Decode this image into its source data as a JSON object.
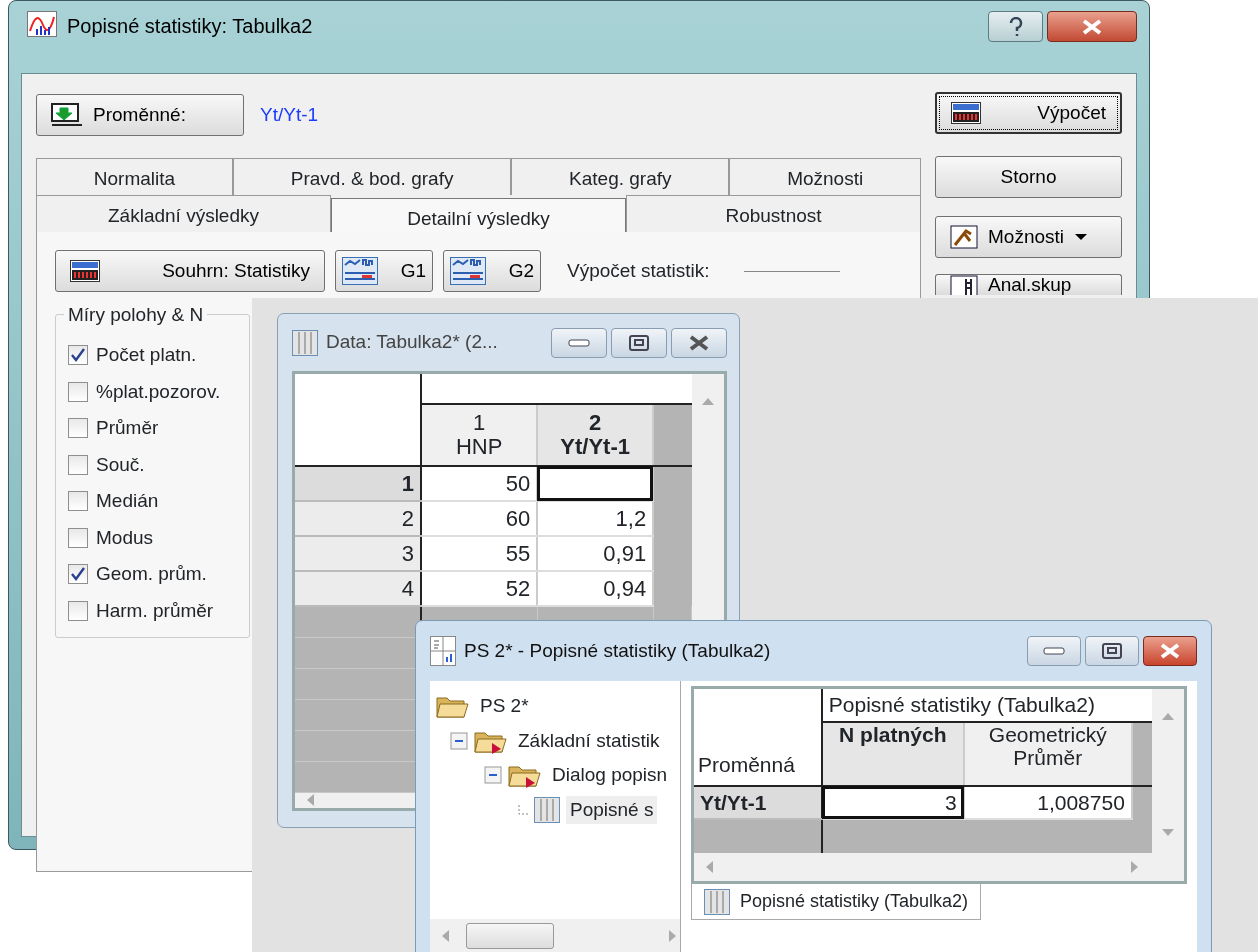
{
  "dialog": {
    "title": "Popisné statistiky: Tabulka2",
    "variables_button": "Proměnné:",
    "variables_value": "Yt/Yt-1",
    "side_buttons": [
      {
        "kind": "default",
        "label": "Výpočet"
      },
      {
        "kind": "plain",
        "label": "Storno"
      },
      {
        "kind": "dropdown",
        "label": "Možnosti"
      },
      {
        "kind": "group",
        "label": "Anal.skup"
      }
    ],
    "tab_rows": [
      [
        {
          "label": "Normalita",
          "selected": false
        },
        {
          "label": "Pravd. & bod. grafy",
          "selected": false
        },
        {
          "label": "Kateg. grafy",
          "selected": false
        },
        {
          "label": "Možnosti",
          "selected": false
        }
      ],
      [
        {
          "label": "Základní výsledky",
          "selected": false
        },
        {
          "label": "Detailní výsledky",
          "selected": true
        },
        {
          "label": "Robustnost",
          "selected": false
        }
      ]
    ],
    "summary_button": "Souhrn: Statistiky",
    "graph_buttons": [
      "G1",
      "G2"
    ],
    "calc_label": "Výpočet statistik:",
    "group": {
      "title": "Míry polohy & N",
      "checkboxes": [
        {
          "label": "Počet platn.",
          "checked": true
        },
        {
          "label": "%plat.pozorov.",
          "checked": false
        },
        {
          "label": "Průměr",
          "checked": false
        },
        {
          "label": "Souč.",
          "checked": false
        },
        {
          "label": "Medián",
          "checked": false
        },
        {
          "label": "Modus",
          "checked": false
        },
        {
          "label": "Geom. prům.",
          "checked": true
        },
        {
          "label": "Harm. průměr",
          "checked": false
        }
      ]
    }
  },
  "data_window": {
    "title": "Data: Tabulka2* (2...",
    "columns": [
      {
        "number": "1",
        "name": "HNP",
        "selected": false
      },
      {
        "number": "2",
        "name": "Yt/Yt-1",
        "selected": true
      }
    ],
    "rows": [
      {
        "number": "1",
        "selected": true,
        "values": [
          "50"
        ]
      },
      {
        "number": "2",
        "selected": false,
        "values": [
          "60",
          "1,2"
        ]
      },
      {
        "number": "3",
        "selected": false,
        "values": [
          "55",
          "0,91"
        ]
      },
      {
        "number": "4",
        "selected": false,
        "values": [
          "52",
          "0,94"
        ]
      }
    ]
  },
  "results_window": {
    "title": "PS 2* - Popisné statistiky (Tabulka2)",
    "tree": [
      {
        "label": "PS 2*",
        "selected": false,
        "children": [
          {
            "label": "Základní statistik",
            "selected": false,
            "children": [
              {
                "label": "Dialog popisn",
                "selected": false,
                "children": [
                  {
                    "label": "Popisné s",
                    "kind": "sheet",
                    "selected": true
                  }
                ]
              }
            ]
          }
        ]
      }
    ],
    "table": {
      "group_header": "Popisné statistiky (Tabulka2)",
      "corner": "Proměnná",
      "columns": [
        {
          "label": "N platných",
          "selected": true
        },
        {
          "label": "Geometrický Průměr",
          "selected": false
        }
      ],
      "rows": [
        {
          "name": "Yt/Yt-1",
          "values": [
            "3",
            "1,008750"
          ]
        }
      ]
    },
    "sheet_tab": "Popisné statistiky (Tabulka2)"
  }
}
